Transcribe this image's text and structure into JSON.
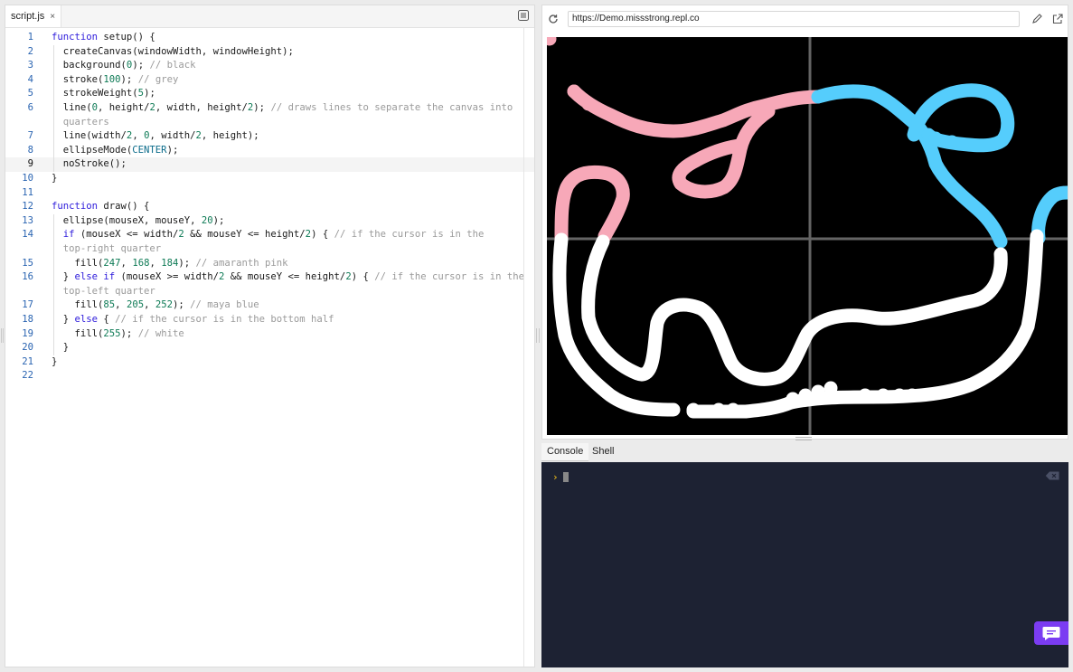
{
  "editor": {
    "tab_label": "script.js",
    "tab_close": "×",
    "active_line": 9,
    "lines": [
      [
        {
          "t": "kw",
          "s": "function"
        },
        {
          "t": "p",
          "s": " setup() {"
        }
      ],
      [
        {
          "t": "p",
          "s": "  createCanvas(windowWidth, windowHeight);"
        }
      ],
      [
        {
          "t": "p",
          "s": "  background("
        },
        {
          "t": "num",
          "s": "0"
        },
        {
          "t": "p",
          "s": "); "
        },
        {
          "t": "cm",
          "s": "// black"
        }
      ],
      [
        {
          "t": "p",
          "s": "  stroke("
        },
        {
          "t": "num",
          "s": "100"
        },
        {
          "t": "p",
          "s": "); "
        },
        {
          "t": "cm",
          "s": "// grey"
        }
      ],
      [
        {
          "t": "p",
          "s": "  strokeWeight("
        },
        {
          "t": "num",
          "s": "5"
        },
        {
          "t": "p",
          "s": ");"
        }
      ],
      [
        {
          "t": "p",
          "s": "  line("
        },
        {
          "t": "num",
          "s": "0"
        },
        {
          "t": "p",
          "s": ", height/"
        },
        {
          "t": "num",
          "s": "2"
        },
        {
          "t": "p",
          "s": ", width, height/"
        },
        {
          "t": "num",
          "s": "2"
        },
        {
          "t": "p",
          "s": "); "
        },
        {
          "t": "cm",
          "s": "// draws lines to separate the canvas into"
        }
      ],
      [
        {
          "t": "cm",
          "s": "  quarters"
        }
      ],
      [
        {
          "t": "p",
          "s": "  line(width/"
        },
        {
          "t": "num",
          "s": "2"
        },
        {
          "t": "p",
          "s": ", "
        },
        {
          "t": "num",
          "s": "0"
        },
        {
          "t": "p",
          "s": ", width/"
        },
        {
          "t": "num",
          "s": "2"
        },
        {
          "t": "p",
          "s": ", height);"
        }
      ],
      [
        {
          "t": "p",
          "s": "  ellipseMode("
        },
        {
          "t": "cst",
          "s": "CENTER"
        },
        {
          "t": "p",
          "s": ");"
        }
      ],
      [
        {
          "t": "p",
          "s": "  noStroke();"
        }
      ],
      [
        {
          "t": "p",
          "s": "}"
        }
      ],
      [],
      [
        {
          "t": "kw",
          "s": "function"
        },
        {
          "t": "p",
          "s": " draw() {"
        }
      ],
      [
        {
          "t": "p",
          "s": "  ellipse(mouseX, mouseY, "
        },
        {
          "t": "num",
          "s": "20"
        },
        {
          "t": "p",
          "s": ");"
        }
      ],
      [
        {
          "t": "p",
          "s": "  "
        },
        {
          "t": "kw",
          "s": "if"
        },
        {
          "t": "p",
          "s": " (mouseX <= width/"
        },
        {
          "t": "num",
          "s": "2"
        },
        {
          "t": "p",
          "s": " && mouseY <= height/"
        },
        {
          "t": "num",
          "s": "2"
        },
        {
          "t": "p",
          "s": ") { "
        },
        {
          "t": "cm",
          "s": "// if the cursor is in the"
        }
      ],
      [
        {
          "t": "cm",
          "s": "  top-right quarter"
        }
      ],
      [
        {
          "t": "p",
          "s": "    fill("
        },
        {
          "t": "num",
          "s": "247"
        },
        {
          "t": "p",
          "s": ", "
        },
        {
          "t": "num",
          "s": "168"
        },
        {
          "t": "p",
          "s": ", "
        },
        {
          "t": "num",
          "s": "184"
        },
        {
          "t": "p",
          "s": "); "
        },
        {
          "t": "cm",
          "s": "// amaranth pink"
        }
      ],
      [
        {
          "t": "p",
          "s": "  } "
        },
        {
          "t": "kw",
          "s": "else if"
        },
        {
          "t": "p",
          "s": " (mouseX >= width/"
        },
        {
          "t": "num",
          "s": "2"
        },
        {
          "t": "p",
          "s": " && mouseY <= height/"
        },
        {
          "t": "num",
          "s": "2"
        },
        {
          "t": "p",
          "s": ") { "
        },
        {
          "t": "cm",
          "s": "// if the cursor is in the"
        }
      ],
      [
        {
          "t": "cm",
          "s": "  top-left quarter"
        }
      ],
      [
        {
          "t": "p",
          "s": "    fill("
        },
        {
          "t": "num",
          "s": "85"
        },
        {
          "t": "p",
          "s": ", "
        },
        {
          "t": "num",
          "s": "205"
        },
        {
          "t": "p",
          "s": ", "
        },
        {
          "t": "num",
          "s": "252"
        },
        {
          "t": "p",
          "s": "); "
        },
        {
          "t": "cm",
          "s": "// maya blue"
        }
      ],
      [
        {
          "t": "p",
          "s": "  } "
        },
        {
          "t": "kw",
          "s": "else"
        },
        {
          "t": "p",
          "s": " { "
        },
        {
          "t": "cm",
          "s": "// if the cursor is in the bottom half"
        }
      ],
      [
        {
          "t": "p",
          "s": "    fill("
        },
        {
          "t": "num",
          "s": "255"
        },
        {
          "t": "p",
          "s": "); "
        },
        {
          "t": "cm",
          "s": "// white"
        }
      ],
      [
        {
          "t": "p",
          "s": "  }"
        }
      ],
      [
        {
          "t": "p",
          "s": "}"
        }
      ],
      []
    ],
    "line_numbers": [
      "1",
      "2",
      "3",
      "4",
      "5",
      "6",
      "",
      "7",
      "8",
      "9",
      "10",
      "11",
      "12",
      "13",
      "14",
      "",
      "15",
      "16",
      "",
      "17",
      "18",
      "19",
      "20",
      "21",
      "22"
    ]
  },
  "preview": {
    "url": "https://Demo.missstrong.repl.co",
    "canvas_colors": {
      "background": "#000000",
      "divider": "#646464",
      "pink": "#f7a8b8",
      "blue": "#55cdfc",
      "white": "#ffffff"
    }
  },
  "console": {
    "tabs": [
      "Console",
      "Shell"
    ],
    "active_tab": "Console",
    "prompt": "›"
  },
  "colors": {
    "keyword": "#2d1bdb",
    "number": "#0d7a55",
    "comment": "#9a9a9a",
    "console_bg": "#1d2233",
    "chat_button": "#7b3cf2"
  }
}
